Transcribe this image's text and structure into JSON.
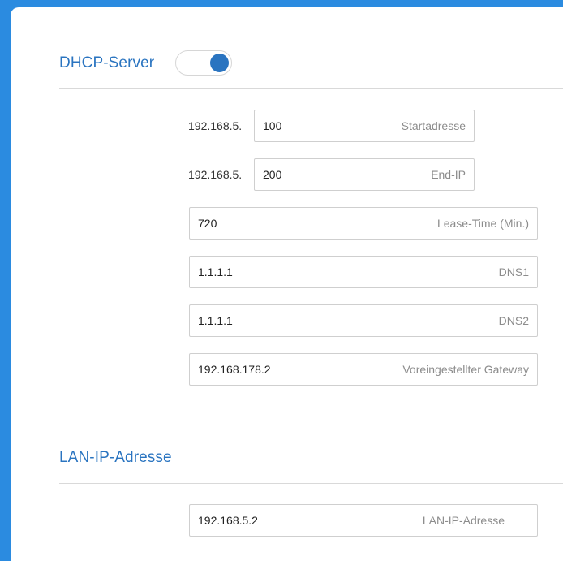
{
  "dhcp": {
    "title": "DHCP-Server",
    "enabled": true,
    "start": {
      "prefix": "192.168.5.",
      "value": "100",
      "placeholder": "Startadresse"
    },
    "end": {
      "prefix": "192.168.5.",
      "value": "200",
      "placeholder": "End-IP"
    },
    "lease": {
      "value": "720",
      "placeholder": "Lease-Time (Min.)"
    },
    "dns1": {
      "value": "1.1.1.1",
      "placeholder": "DNS1"
    },
    "dns2": {
      "value": "1.1.1.1",
      "placeholder": "DNS2"
    },
    "gateway": {
      "value": "192.168.178.2",
      "placeholder": "Voreingestellter Gateway"
    }
  },
  "lan": {
    "title": "LAN-IP-Adresse",
    "ip": {
      "value": "192.168.5.2",
      "placeholder": "LAN-IP-Adresse"
    }
  },
  "colors": {
    "accent": "#2a74c0",
    "frame": "#2b8be0"
  }
}
